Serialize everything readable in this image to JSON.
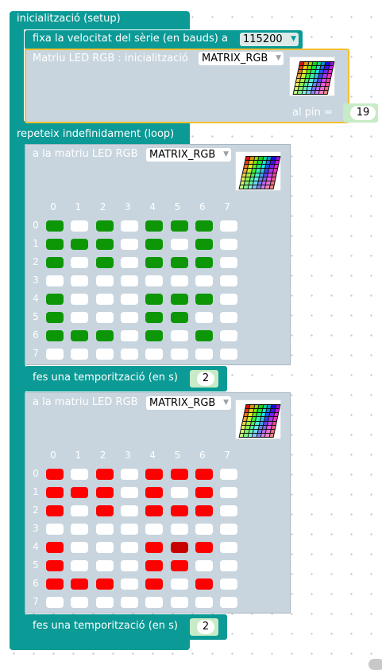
{
  "setup": {
    "header": "inicialització (setup)",
    "serial": {
      "label": "fixa la velocitat del sèrie (en bauds) a",
      "value": "115200"
    },
    "matrix_init": {
      "label": "Matriu LED RGB : inicialització",
      "name": "MATRIX_RGB",
      "pin_label": "al pin =",
      "pin_value": "19"
    }
  },
  "loop": {
    "header": "repeteix indefinidament (loop)",
    "blocks": [
      {
        "label": "a la matriu LED RGB",
        "name": "MATRIX_RGB",
        "color": "#0d9707",
        "column_labels": [
          "0",
          "1",
          "2",
          "3",
          "4",
          "5",
          "6",
          "7"
        ],
        "row_labels": [
          "0",
          "1",
          "2",
          "3",
          "4",
          "5",
          "6",
          "7"
        ],
        "grid": [
          [
            1,
            0,
            1,
            0,
            1,
            1,
            1,
            0
          ],
          [
            1,
            1,
            1,
            0,
            1,
            0,
            1,
            0
          ],
          [
            1,
            0,
            1,
            0,
            1,
            1,
            1,
            0
          ],
          [
            0,
            0,
            0,
            0,
            0,
            0,
            0,
            0
          ],
          [
            1,
            0,
            0,
            0,
            1,
            1,
            1,
            0
          ],
          [
            1,
            0,
            0,
            0,
            1,
            1,
            0,
            0
          ],
          [
            1,
            1,
            1,
            0,
            1,
            0,
            1,
            0
          ],
          [
            0,
            0,
            0,
            0,
            0,
            0,
            0,
            0
          ]
        ],
        "delay": {
          "label": "fes una temporització (en s)",
          "value": "2"
        }
      },
      {
        "label": "a la matriu LED RGB",
        "name": "MATRIX_RGB",
        "color": "#ff0000",
        "column_labels": [
          "0",
          "1",
          "2",
          "3",
          "4",
          "5",
          "6",
          "7"
        ],
        "row_labels": [
          "0",
          "1",
          "2",
          "3",
          "4",
          "5",
          "6",
          "7"
        ],
        "grid": [
          [
            1,
            0,
            1,
            0,
            1,
            1,
            1,
            0
          ],
          [
            1,
            1,
            1,
            0,
            1,
            0,
            1,
            0
          ],
          [
            1,
            0,
            1,
            0,
            1,
            1,
            1,
            0
          ],
          [
            0,
            0,
            0,
            0,
            0,
            0,
            0,
            0
          ],
          [
            1,
            0,
            0,
            0,
            1,
            2,
            1,
            0
          ],
          [
            1,
            0,
            0,
            0,
            1,
            1,
            0,
            0
          ],
          [
            1,
            1,
            1,
            0,
            1,
            0,
            1,
            0
          ],
          [
            0,
            0,
            0,
            0,
            0,
            0,
            0,
            0
          ]
        ],
        "delay": {
          "label": "fes una temporització (en s)",
          "value": "2"
        }
      }
    ]
  }
}
